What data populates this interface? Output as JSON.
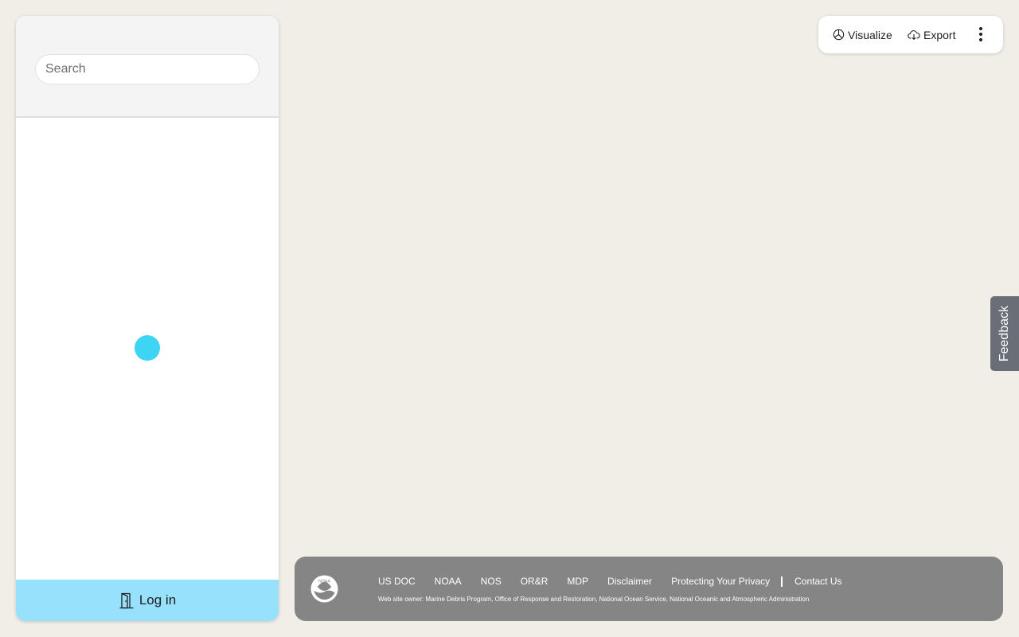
{
  "colors": {
    "page_background": "#f1eee8",
    "loader_accent": "#3dd5f3",
    "login_bar_background": "#97e1fd",
    "footer_background": "#858585",
    "feedback_background": "#6a6f77"
  },
  "sidebar": {
    "search": {
      "placeholder": "Search",
      "value": ""
    },
    "login": {
      "label": "Log in",
      "icon": "door-icon"
    }
  },
  "toolbar": {
    "visualize": {
      "label": "Visualize",
      "icon": "pie-chart-icon"
    },
    "export": {
      "label": "Export",
      "icon": "cloud-download-icon"
    },
    "more": {
      "icon": "more-vertical-icon"
    }
  },
  "feedback": {
    "label": "Feedback"
  },
  "footer": {
    "logo": {
      "icon": "noaa-logo",
      "text": "NOAA"
    },
    "links": {
      "us_doc": "US DOC",
      "noaa": "NOAA",
      "nos": "NOS",
      "orr": "OR&R",
      "mdp": "MDP",
      "disclaimer": "Disclaimer",
      "privacy": "Protecting Your Privacy",
      "contact": "Contact Us"
    },
    "owner": "Web site owner: Marine Debris Program, Office of Response and Restoration, National Ocean Service, National Oceanic and Atmospheric Administration"
  }
}
